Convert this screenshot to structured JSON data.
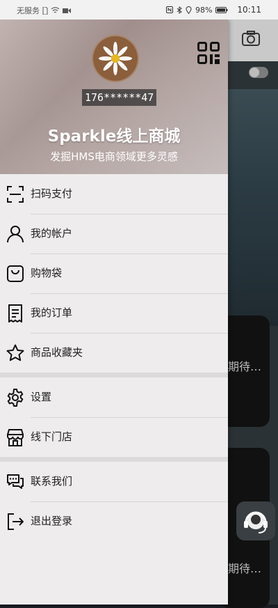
{
  "status_bar": {
    "carrier": "无服务",
    "battery": "98%",
    "time": "10:11"
  },
  "user": {
    "phone": "176******47"
  },
  "app": {
    "title": "Sparkle线上商城",
    "subtitle": "发掘HMS电商领域更多灵感"
  },
  "menu": {
    "group1": [
      {
        "label": "扫码支付",
        "icon": "scan-icon"
      },
      {
        "label": "我的帐户",
        "icon": "user-icon"
      },
      {
        "label": "购物袋",
        "icon": "bag-icon"
      },
      {
        "label": "我的订单",
        "icon": "order-icon"
      },
      {
        "label": "商品收藏夹",
        "icon": "star-icon"
      }
    ],
    "group2": [
      {
        "label": "设置",
        "icon": "gear-icon"
      },
      {
        "label": "线下门店",
        "icon": "store-icon"
      }
    ],
    "group3": [
      {
        "label": "联系我们",
        "icon": "chat-icon"
      },
      {
        "label": "退出登录",
        "icon": "logout-icon"
      }
    ]
  },
  "background": {
    "card1_text": "期待…",
    "card2_text": "期待…"
  }
}
